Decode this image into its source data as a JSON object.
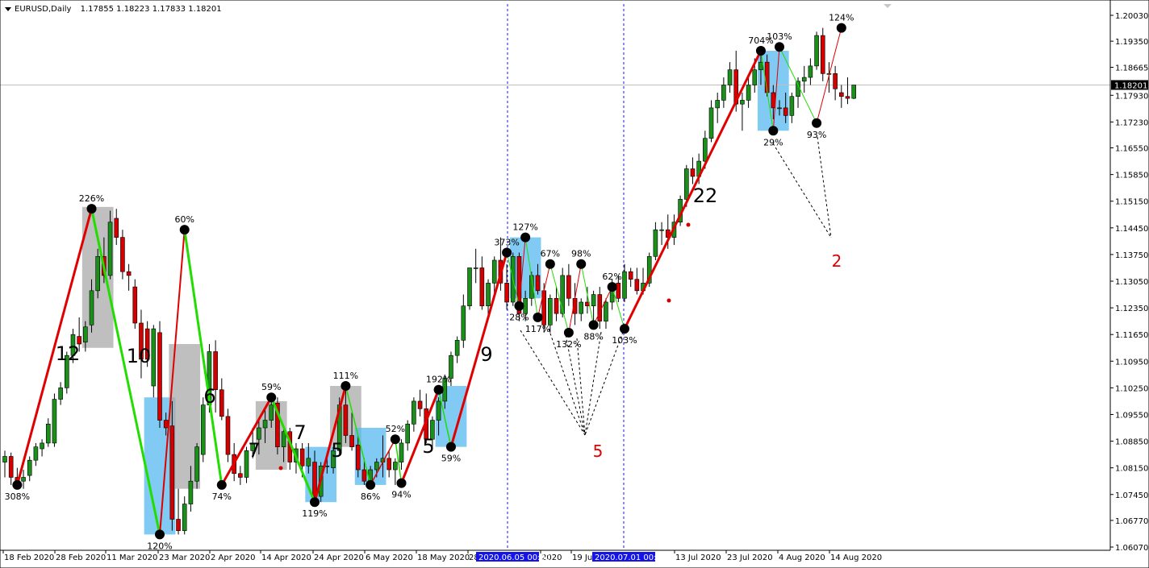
{
  "header": {
    "symbol": "EURUSD,Daily",
    "ohlc": "1.17855 1.18223 1.17833 1.18201"
  },
  "chart_data": {
    "type": "candlestick",
    "y_ticks": [
      "1.20030",
      "1.19350",
      "1.18665",
      "1.17930",
      "1.17230",
      "1.16550",
      "1.15850",
      "1.15150",
      "1.14450",
      "1.13750",
      "1.13050",
      "1.12350",
      "1.11650",
      "1.10950",
      "1.10250",
      "1.09550",
      "1.08850",
      "1.08150",
      "1.07450",
      "1.06770",
      "1.06070"
    ],
    "ylim": [
      1.0607,
      1.2003
    ],
    "current_price": "1.18201",
    "x_ticks": [
      "18 Feb 2020",
      "28 Feb 2020",
      "11 Mar 2020",
      "23 Mar 2020",
      "2 Apr 2020",
      "14 Apr 2020",
      "24 Apr 2020",
      "6 May 2020",
      "18 May 2020",
      "28",
      "2020",
      "19 Jun",
      "13 Jul 2020",
      "23 Jul 2020",
      "4 Aug 2020",
      "14 Aug 2020"
    ],
    "x_highlights": [
      "2020.06.05 00:00",
      "2020.07.01 00:00"
    ],
    "candles": [
      [
        1.083,
        1.086,
        1.079,
        1.0845
      ],
      [
        1.0845,
        1.0855,
        1.077,
        1.079
      ],
      [
        1.079,
        1.0815,
        1.077,
        1.078
      ],
      [
        1.078,
        1.081,
        1.076,
        1.079
      ],
      [
        1.0795,
        1.0845,
        1.078,
        1.0835
      ],
      [
        1.0835,
        1.088,
        1.082,
        1.087
      ],
      [
        1.0865,
        1.089,
        1.0845,
        1.088
      ],
      [
        1.088,
        1.0945,
        1.087,
        1.093
      ],
      [
        1.088,
        1.101,
        1.087,
        1.0995
      ],
      [
        1.0995,
        1.104,
        1.098,
        1.1025
      ],
      [
        1.1025,
        1.112,
        1.101,
        1.111
      ],
      [
        1.111,
        1.118,
        1.109,
        1.1165
      ],
      [
        1.116,
        1.121,
        1.112,
        1.114
      ],
      [
        1.1145,
        1.12,
        1.112,
        1.1185
      ],
      [
        1.119,
        1.131,
        1.117,
        1.128
      ],
      [
        1.128,
        1.139,
        1.126,
        1.137
      ],
      [
        1.137,
        1.142,
        1.13,
        1.132
      ],
      [
        1.132,
        1.149,
        1.131,
        1.146
      ],
      [
        1.147,
        1.1495,
        1.14,
        1.142
      ],
      [
        1.142,
        1.144,
        1.131,
        1.133
      ],
      [
        1.133,
        1.135,
        1.128,
        1.132
      ],
      [
        1.129,
        1.131,
        1.118,
        1.1195
      ],
      [
        1.1195,
        1.123,
        1.105,
        1.11
      ],
      [
        1.118,
        1.12,
        1.108,
        1.11
      ],
      [
        1.103,
        1.119,
        1.1,
        1.118
      ],
      [
        1.117,
        1.12,
        1.092,
        1.094
      ],
      [
        1.094,
        1.096,
        1.09,
        1.092
      ],
      [
        1.0925,
        1.099,
        1.065,
        1.068
      ],
      [
        1.068,
        1.076,
        1.064,
        1.065
      ],
      [
        1.065,
        1.074,
        1.064,
        1.072
      ],
      [
        1.072,
        1.082,
        1.07,
        1.078
      ],
      [
        1.078,
        1.088,
        1.076,
        1.087
      ],
      [
        1.085,
        1.1,
        1.083,
        1.098
      ],
      [
        1.098,
        1.114,
        1.096,
        1.112
      ],
      [
        1.112,
        1.115,
        1.096,
        1.102
      ],
      [
        1.102,
        1.105,
        1.094,
        1.095
      ],
      [
        1.095,
        1.097,
        1.083,
        1.085
      ],
      [
        1.085,
        1.088,
        1.078,
        1.08
      ],
      [
        1.08,
        1.082,
        1.077,
        1.079
      ],
      [
        1.079,
        1.087,
        1.0775,
        1.086
      ],
      [
        1.086,
        1.092,
        1.084,
        1.088
      ],
      [
        1.089,
        1.094,
        1.085,
        1.092
      ],
      [
        1.092,
        1.097,
        1.088,
        1.094
      ],
      [
        1.094,
        1.099,
        1.092,
        1.098
      ],
      [
        1.0985,
        1.1,
        1.085,
        1.087
      ],
      [
        1.087,
        1.092,
        1.083,
        1.091
      ],
      [
        1.091,
        1.092,
        1.081,
        1.083
      ],
      [
        1.083,
        1.088,
        1.08,
        1.0865
      ],
      [
        1.0865,
        1.088,
        1.079,
        1.082
      ],
      [
        1.082,
        1.088,
        1.08,
        1.084
      ],
      [
        1.083,
        1.086,
        1.072,
        1.074
      ],
      [
        1.074,
        1.083,
        1.0725,
        1.082
      ],
      [
        1.082,
        1.084,
        1.08,
        1.082
      ],
      [
        1.0815,
        1.087,
        1.08,
        1.086
      ],
      [
        1.086,
        1.1,
        1.085,
        1.098
      ],
      [
        1.098,
        1.103,
        1.088,
        1.09
      ],
      [
        1.09,
        1.096,
        1.086,
        1.087
      ],
      [
        1.0875,
        1.09,
        1.079,
        1.081
      ],
      [
        1.081,
        1.084,
        1.077,
        1.078
      ],
      [
        1.078,
        1.082,
        1.076,
        1.081
      ],
      [
        1.081,
        1.084,
        1.079,
        1.083
      ],
      [
        1.083,
        1.09,
        1.079,
        1.084
      ],
      [
        1.084,
        1.086,
        1.079,
        1.081
      ],
      [
        1.081,
        1.084,
        1.077,
        1.083
      ],
      [
        1.083,
        1.089,
        1.081,
        1.088
      ],
      [
        1.088,
        1.094,
        1.086,
        1.093
      ],
      [
        1.093,
        1.1,
        1.091,
        1.099
      ],
      [
        1.099,
        1.102,
        1.095,
        1.097
      ],
      [
        1.097,
        1.101,
        1.088,
        1.089
      ],
      [
        1.089,
        1.095,
        1.087,
        1.094
      ],
      [
        1.094,
        1.1,
        1.09,
        1.099
      ],
      [
        1.099,
        1.106,
        1.097,
        1.105
      ],
      [
        1.105,
        1.112,
        1.103,
        1.111
      ],
      [
        1.111,
        1.116,
        1.109,
        1.115
      ],
      [
        1.115,
        1.127,
        1.113,
        1.124
      ],
      [
        1.124,
        1.134,
        1.123,
        1.134
      ],
      [
        1.134,
        1.139,
        1.13,
        1.134
      ],
      [
        1.134,
        1.137,
        1.123,
        1.124
      ],
      [
        1.124,
        1.131,
        1.121,
        1.13
      ],
      [
        1.13,
        1.137,
        1.127,
        1.136
      ],
      [
        1.136,
        1.142,
        1.128,
        1.13
      ],
      [
        1.13,
        1.135,
        1.123,
        1.125
      ],
      [
        1.125,
        1.138,
        1.124,
        1.137
      ],
      [
        1.137,
        1.138,
        1.12,
        1.122
      ],
      [
        1.122,
        1.128,
        1.12,
        1.126
      ],
      [
        1.126,
        1.133,
        1.124,
        1.132
      ],
      [
        1.132,
        1.135,
        1.127,
        1.128
      ],
      [
        1.128,
        1.13,
        1.117,
        1.119
      ],
      [
        1.119,
        1.127,
        1.117,
        1.126
      ],
      [
        1.126,
        1.129,
        1.12,
        1.122
      ],
      [
        1.122,
        1.134,
        1.121,
        1.132
      ],
      [
        1.132,
        1.135,
        1.124,
        1.126
      ],
      [
        1.126,
        1.13,
        1.119,
        1.122
      ],
      [
        1.122,
        1.126,
        1.12,
        1.125
      ],
      [
        1.125,
        1.129,
        1.122,
        1.124
      ],
      [
        1.124,
        1.128,
        1.12,
        1.127
      ],
      [
        1.127,
        1.129,
        1.118,
        1.12
      ],
      [
        1.12,
        1.126,
        1.118,
        1.125
      ],
      [
        1.125,
        1.131,
        1.123,
        1.13
      ],
      [
        1.13,
        1.132,
        1.125,
        1.126
      ],
      [
        1.126,
        1.135,
        1.125,
        1.133
      ],
      [
        1.133,
        1.134,
        1.129,
        1.131
      ],
      [
        1.131,
        1.134,
        1.127,
        1.128
      ],
      [
        1.128,
        1.134,
        1.127,
        1.13
      ],
      [
        1.13,
        1.138,
        1.129,
        1.137
      ],
      [
        1.137,
        1.146,
        1.136,
        1.144
      ],
      [
        1.144,
        1.146,
        1.14,
        1.144
      ],
      [
        1.144,
        1.148,
        1.139,
        1.142
      ],
      [
        1.142,
        1.148,
        1.14,
        1.146
      ],
      [
        1.146,
        1.153,
        1.145,
        1.152
      ],
      [
        1.152,
        1.161,
        1.15,
        1.16
      ],
      [
        1.16,
        1.163,
        1.156,
        1.158
      ],
      [
        1.158,
        1.164,
        1.156,
        1.162
      ],
      [
        1.162,
        1.17,
        1.16,
        1.168
      ],
      [
        1.168,
        1.178,
        1.167,
        1.176
      ],
      [
        1.176,
        1.18,
        1.172,
        1.178
      ],
      [
        1.178,
        1.184,
        1.176,
        1.182
      ],
      [
        1.182,
        1.188,
        1.18,
        1.186
      ],
      [
        1.186,
        1.191,
        1.175,
        1.177
      ],
      [
        1.177,
        1.18,
        1.17,
        1.178
      ],
      [
        1.178,
        1.184,
        1.176,
        1.182
      ],
      [
        1.182,
        1.189,
        1.18,
        1.186
      ],
      [
        1.186,
        1.191,
        1.182,
        1.188
      ],
      [
        1.188,
        1.19,
        1.179,
        1.18
      ],
      [
        1.18,
        1.182,
        1.173,
        1.176
      ],
      [
        1.176,
        1.178,
        1.174,
        1.176
      ],
      [
        1.176,
        1.18,
        1.172,
        1.174
      ],
      [
        1.174,
        1.18,
        1.172,
        1.179
      ],
      [
        1.179,
        1.184,
        1.176,
        1.183
      ],
      [
        1.183,
        1.187,
        1.18,
        1.184
      ],
      [
        1.184,
        1.189,
        1.182,
        1.187
      ],
      [
        1.187,
        1.196,
        1.186,
        1.195
      ],
      [
        1.195,
        1.197,
        1.183,
        1.185
      ],
      [
        1.185,
        1.188,
        1.18,
        1.185
      ],
      [
        1.185,
        1.187,
        1.178,
        1.181
      ],
      [
        1.18,
        1.182,
        1.176,
        1.179
      ],
      [
        1.179,
        1.184,
        1.177,
        1.1785
      ],
      [
        1.1785,
        1.182,
        1.1783,
        1.182
      ]
    ],
    "zigzag_labels": [
      "308%",
      "226%",
      "120%",
      "60%",
      "74%",
      "59%",
      "119%",
      "111%",
      "86%",
      "52%",
      "94%",
      "192%",
      "59%",
      "373%",
      "127%",
      "28%",
      "117%",
      "67%",
      "132%",
      "98%",
      "88%",
      "62%",
      "103%",
      "704%",
      "29%",
      "103%",
      "93%",
      "124%"
    ],
    "wave_counts": [
      "12",
      "10",
      "6",
      "7",
      "7",
      "5",
      "5",
      "9",
      "22"
    ],
    "annotations": [
      "5",
      "2"
    ],
    "colors": {
      "bull": "#1a8f1a",
      "bear": "#d40000",
      "up_leg": "#e00000",
      "down_leg": "#22dd00",
      "grey_box": "#a9a9a9",
      "blue_box": "#57b8f0",
      "highlight_bg": "#1414e6",
      "marker_dot": "#000000",
      "red_number": "#e00000"
    }
  }
}
